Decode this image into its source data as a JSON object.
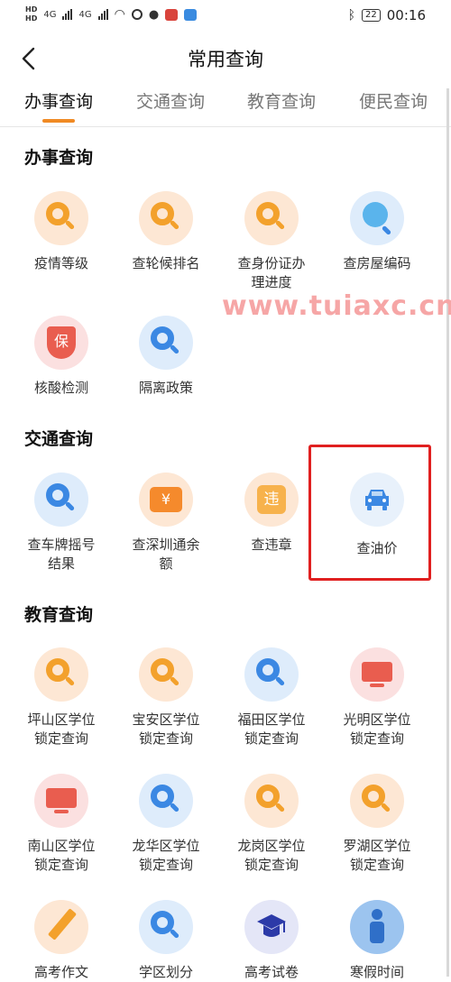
{
  "status_bar": {
    "network_top": "HD",
    "network_bottom": "HD",
    "sig1": "4G",
    "sig2": "4G",
    "battery": "22",
    "time": "00:16"
  },
  "header": {
    "title": "常用查询"
  },
  "tabs": [
    "办事查询",
    "交通查询",
    "教育查询",
    "便民查询"
  ],
  "sections": {
    "banshi": {
      "title": "办事查询",
      "items": [
        "疫情等级",
        "查轮候排名",
        "查身份证办理进度",
        "查房屋编码",
        "核酸检测",
        "隔离政策"
      ]
    },
    "jiaotong": {
      "title": "交通查询",
      "items": [
        "查车牌摇号结果",
        "查深圳通余额",
        "查违章",
        "查油价"
      ]
    },
    "jiaoyu": {
      "title": "教育查询",
      "items": [
        "坪山区学位锁定查询",
        "宝安区学位锁定查询",
        "福田区学位锁定查询",
        "光明区学位锁定查询",
        "南山区学位锁定查询",
        "龙华区学位锁定查询",
        "龙岗区学位锁定查询",
        "罗湖区学位锁定查询",
        "高考作文",
        "学区划分",
        "高考试卷",
        "寒假时间"
      ]
    }
  },
  "icon_glyphs": {
    "shield": "保",
    "yen": "¥",
    "violation": "违"
  },
  "watermark": "www.tuiaxc.cn",
  "colors": {
    "orange": "#f3a12c",
    "blue": "#3b88e3",
    "red": "#e95d4f",
    "tab_indicator": "#f08a24",
    "highlight": "#e02020"
  }
}
